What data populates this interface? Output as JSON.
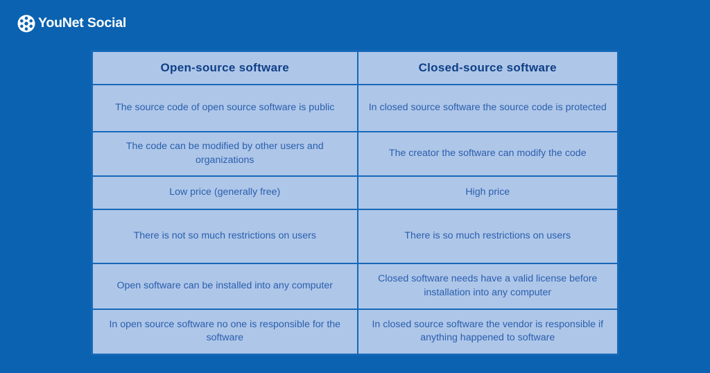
{
  "brand": {
    "name": "YouNet Social",
    "logo_icon": "younet-network-circle-icon",
    "logo_color": "#ffffff",
    "text_color": "#ffffff"
  },
  "colors": {
    "page_background": "#0a62b0",
    "cell_background": "#aec6e8",
    "cell_border": "#1668b8",
    "header_text": "#0f3f86",
    "body_text": "#2a5fae"
  },
  "table": {
    "headers": [
      "Open-source software",
      "Closed-source software"
    ],
    "rows": [
      [
        "The source code of open source software is public",
        "In closed source software the source code is protected"
      ],
      [
        "The code can be modified by other users and organizations",
        "The creator the software can modify the code"
      ],
      [
        "Low price (generally free)",
        "High price"
      ],
      [
        "There is not so much restrictions on users",
        "There is so much restrictions on users"
      ],
      [
        "Open software can be installed into any computer",
        "Closed software needs have a valid license before installation into any computer"
      ],
      [
        "In open source software no one is responsible for the software",
        "In closed source software the vendor is responsible if anything happened to software"
      ]
    ]
  }
}
